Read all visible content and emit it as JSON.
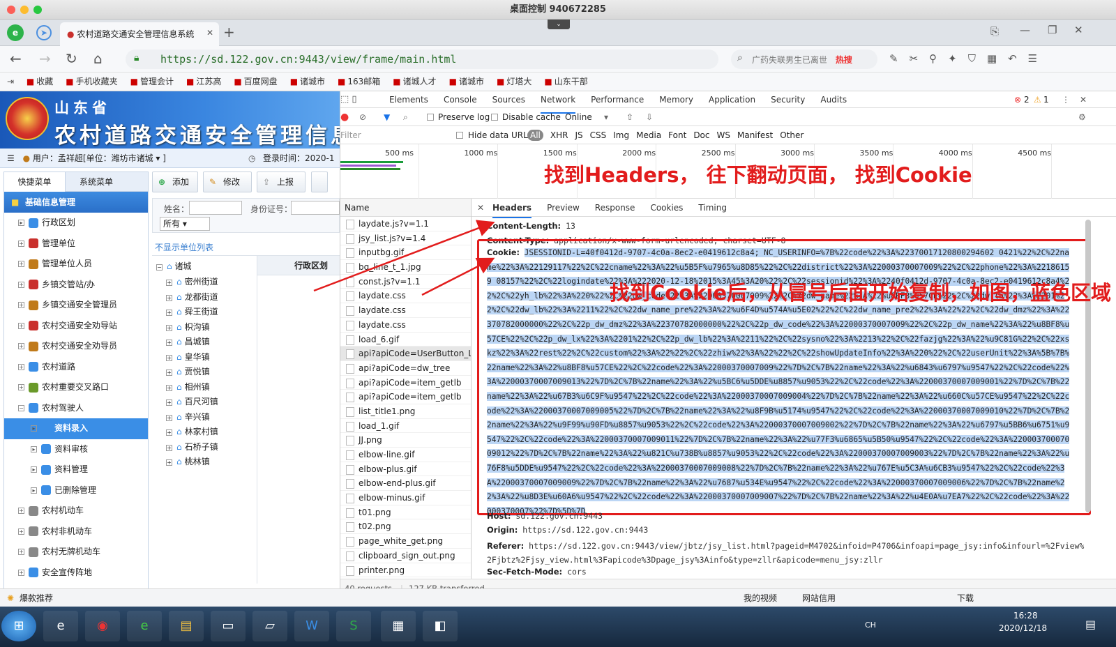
{
  "window": {
    "title": "桌面控制 940672285"
  },
  "browser": {
    "tab_title": "农村道路交通安全管理信息系统",
    "url": "https://sd.122.gov.cn:9443/view/frame/main.html",
    "search_placeholder": "广药失联男生已离世",
    "search_hot": "热搜",
    "bookmarks": [
      "收藏",
      "手机收藏夹",
      "管理会计",
      "江苏高",
      "百度网盘",
      "诸城市",
      "163邮箱",
      "诸城人才",
      "诸城市",
      "灯塔大",
      "山东干部"
    ]
  },
  "app": {
    "province": "山东省",
    "system_name": "农村道路交通安全管理信息",
    "user_label": "用户：孟祥超[单位：潍坊市诸城 ▾ ]",
    "login_time": "登录时间：2020-1",
    "menu_tabs": [
      "快捷菜单",
      "系统菜单"
    ],
    "menu_head": "基础信息管理",
    "menu_items": [
      {
        "label": "行政区划",
        "pm": "▸",
        "sub": false
      },
      {
        "label": "管理单位",
        "pm": "+",
        "sub": false
      },
      {
        "label": "管理单位人员",
        "pm": "+",
        "sub": false
      },
      {
        "label": "乡镇交管站/办",
        "pm": "+",
        "sub": false
      },
      {
        "label": "乡镇交通安全管理员",
        "pm": "+",
        "sub": false
      },
      {
        "label": "农村交通安全劝导站",
        "pm": "+",
        "sub": false
      },
      {
        "label": "农村交通安全劝导员",
        "pm": "+",
        "sub": false
      },
      {
        "label": "农村道路",
        "pm": "+",
        "sub": false
      },
      {
        "label": "农村重要交叉路口",
        "pm": "+",
        "sub": false
      },
      {
        "label": "农村驾驶人",
        "pm": "−",
        "sub": false
      },
      {
        "label": "资料录入",
        "pm": "▸",
        "sub": true,
        "selected": true
      },
      {
        "label": "资料审核",
        "pm": "▸",
        "sub": true
      },
      {
        "label": "资料管理",
        "pm": "▸",
        "sub": true
      },
      {
        "label": "已删除管理",
        "pm": "▸",
        "sub": true
      },
      {
        "label": "农村机动车",
        "pm": "+",
        "sub": false
      },
      {
        "label": "农村非机动车",
        "pm": "+",
        "sub": false
      },
      {
        "label": "农村无牌机动车",
        "pm": "+",
        "sub": false
      },
      {
        "label": "安全宣传阵地",
        "pm": "+",
        "sub": false
      }
    ],
    "toolbar": {
      "add": "添加",
      "edit": "修改",
      "report": "上报"
    },
    "form": {
      "name_label": "姓名：",
      "id_label": "身份证号：",
      "select_value": "所有 ▾"
    },
    "hide_unit_list": "不显示单位列表",
    "tree_root": "诸城",
    "tree_items": [
      "密州街道",
      "龙都街道",
      "舜王街道",
      "枳沟镇",
      "昌城镇",
      "皇华镇",
      "贾悦镇",
      "相州镇",
      "百尺河镇",
      "辛兴镇",
      "林家村镇",
      "石桥子镇",
      "桃林镇"
    ],
    "grid_header": "行政区划",
    "recommend": "爆款推荐"
  },
  "devtools": {
    "tabs": [
      "Elements",
      "Console",
      "Sources",
      "Network",
      "Performance",
      "Memory",
      "Application",
      "Security",
      "Audits"
    ],
    "active_tab": "Network",
    "errors": "2",
    "warnings": "1",
    "preserve_log": "Preserve log",
    "disable_cache": "Disable cache",
    "throttle": "Online",
    "filter_placeholder": "Filter",
    "hide_data_urls": "Hide data URLs",
    "filter_types": [
      "All",
      "XHR",
      "JS",
      "CSS",
      "Img",
      "Media",
      "Font",
      "Doc",
      "WS",
      "Manifest",
      "Other"
    ],
    "timeline_ticks": [
      "500 ms",
      "1000 ms",
      "1500 ms",
      "2000 ms",
      "2500 ms",
      "3000 ms",
      "3500 ms",
      "4000 ms",
      "4500 ms"
    ],
    "name_header": "Name",
    "requests": [
      "laydate.js?v=1.1",
      "jsy_list.js?v=1.4",
      "inputbg.gif",
      "bg_line_t_1.jpg",
      "const.js?v=1.1",
      "laydate.css",
      "laydate.css",
      "laydate.css",
      "load_6.gif",
      "api?apiCode=UserButton_LIST",
      "api?apiCode=dw_tree",
      "api?apiCode=item_getlb",
      "api?apiCode=item_getlb",
      "list_title1.png",
      "load_1.gif",
      "JJ.png",
      "elbow-line.gif",
      "elbow-plus.gif",
      "elbow-end-plus.gif",
      "elbow-minus.gif",
      "t01.png",
      "t02.png",
      "page_white_get.png",
      "clipboard_sign_out.png",
      "printer.png"
    ],
    "summary_requests": "40 requests",
    "summary_transferred": "127 KB transferred",
    "header_tabs": [
      "Headers",
      "Preview",
      "Response",
      "Cookies",
      "Timing"
    ],
    "content_length": {
      "name": "Content-Length:",
      "value": "13"
    },
    "content_type": {
      "name": "Content-Type:",
      "value": "application/x-www-form-urlencoded; charset=UTF-8"
    },
    "cookie_label": "Cookie:",
    "cookie_value": "JSESSIONID-L=40f0412d-9707-4c0a-8ec2-e0419612c8a4; NC_USERINFO=%7B%22code%22%3A%22370017120800294602 0421%22%2C%22name%22%3A%22129117%22%2C%22cname%22%3A%22%u5B5F%u7965%u8D85%22%2C%22district%22%3A%22000370007009%22%2C%22phone%22%3A%22186159 08157%22%2C%22logindate%22%3A%222020-12-18%2015%3A45%3A20%22%2C%22sessionid%22%3A%2240f0412d-9707-4c0a-8ec2-e0419612c8a4%22%2C%22yh_lb%22%3A%220%22%2C%22dw_code%22%3A%22000370007009%22%2C%22dw_name%22%3A%22%u8BF8%u57CE%22%2C%22dw_lb%22%3A%2201%22%2C%22dw_lb%22%3A%2211%22%2C%22dw_name_pre%22%3A%22%u6F4D%u574A%u5E02%22%2C%22dw_name_pre2%22%3A%22%22%2C%22dw_dmz%22%3A%22370782000000%22%2C%22p_dw_dmz%22%3A%22370782000000%22%2C%22p_dw_code%22%3A%22000370007009%22%2C%22p_dw_name%22%3A%22%u8BF8%u57CE%22%2C%22p_dw_lx%22%3A%2201%22%2C%22p_dw_lb%22%3A%2211%22%2C%22sysno%22%3A%2213%22%2C%22fazjg%22%3A%22%u9C81G%22%2C%22xskz%22%3A%22rest%22%2C%22custom%22%3A%22%22%2C%22zhiw%22%3A%22%22%2C%22showUpdateInfo%22%3A%220%22%2C%22userUnit%22%3A%5B%7B%22name%22%3A%22%u8BF8%u57CE%22%2C%22code%22%3A%22000370007009%22%7D%2C%7B%22name%22%3A%22%u6843%u6797%u9547%22%2C%22code%22%3A%22000370007009013%22%7D%2C%7B%22name%22%3A%22%u5BC6%u5DDE%u8857%u9053%22%2C%22code%22%3A%22000370007009001%22%7D%2C%7B%22name%22%3A%22%u67B3%u6C9F%u9547%22%2C%22code%22%3A%22000370007009004%22%7D%2C%7B%22name%22%3A%22%u660C%u57CE%u9547%22%2C%22code%22%3A%22000370007009005%22%7D%2C%7B%22name%22%3A%22%u8F9B%u5174%u9547%22%2C%22code%22%3A%22000370007009010%22%7D%2C%7B%22name%22%3A%22%u9F99%u90FD%u8857%u9053%22%2C%22code%22%3A%22000370007009002%22%7D%2C%7B%22name%22%3A%22%u6797%u5BB6%u6751%u9547%22%2C%22code%22%3A%22000370007009011%22%7D%2C%7B%22name%22%3A%22%u77F3%u6865%u5B50%u9547%22%2C%22code%22%3A%22000370007009012%22%7D%2C%7B%22name%22%3A%22%u821C%u738B%u8857%u9053%22%2C%22code%22%3A%22000370007009003%22%7D%2C%7B%22name%22%3A%22%u76F8%u5DDE%u9547%22%2C%22code%22%3A%22000370007009008%22%7D%2C%7B%22name%22%3A%22%u767E%u5C3A%u6CB3%u9547%22%2C%22code%22%3A%22000370007009009%22%7D%2C%7B%22name%22%3A%22%u7687%u534E%u9547%22%2C%22code%22%3A%22000370007009006%22%7D%2C%7B%22name%22%3A%22%u8D3E%u60A6%u9547%22%2C%22code%22%3A%22000370007009007%22%7D%2C%7B%22name%22%3A%22%u4E0A%u7EA7%22%2C%22code%22%3A%22000370007%22%7D%5D%7D",
    "host": {
      "name": "Host:",
      "value": "sd.122.gov.cn:9443"
    },
    "origin": {
      "name": "Origin:",
      "value": "https://sd.122.gov.cn:9443"
    },
    "referer": {
      "name": "Referer:",
      "value": "https://sd.122.gov.cn:9443/view/jbtz/jsy_list.html?pageid=M4702&infoid=P4706&infoapi=page_jsy:info&infourl=%2Fview%2Fjbtz%2Fjsy_view.html%3Fapicode%3Dpage_jsy%3Ainfo&type=zllr&apicode=menu_jsy:zllr"
    },
    "sec_fetch_mode": {
      "name": "Sec-Fetch-Mode:",
      "value": "cors"
    }
  },
  "annotations": {
    "top": "找到Headers，  往下翻动页面，  找到Cookie",
    "middle": "找到Cookie后，从冒号后面开始复制，如图，蓝色区域"
  },
  "statusbar": {
    "video": "我的视频",
    "wifi": "网站信用",
    "download": "下载"
  },
  "taskbar": {
    "time": "16:28",
    "date": "2020/12/18",
    "lang": "CH"
  },
  "colors": {
    "accent_red": "#e21c1c",
    "selection": "#bcd6f5",
    "app_blue": "#2a6fc8"
  }
}
